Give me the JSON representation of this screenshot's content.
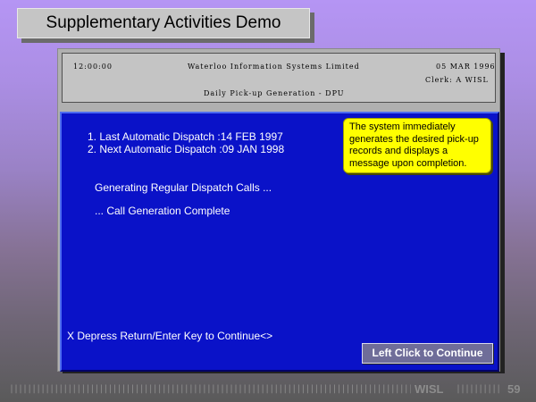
{
  "title": "Supplementary Activities Demo",
  "header": {
    "time": "12:00:00",
    "company": "Waterloo Information Systems Limited",
    "date": "05 MAR 1996",
    "clerk": "Clerk:  A WISL",
    "screen_title": "Daily Pick-up Generation - DPU"
  },
  "main": {
    "line1": "1. Last Automatic Dispatch :14 FEB 1997",
    "line2": "2. Next Automatic Dispatch :09 JAN 1998",
    "status1": "Generating Regular Dispatch Calls ...",
    "status2": "... Call Generation Complete",
    "prompt": "X Depress Return/Enter Key to Continue<>"
  },
  "note": "The system immediately\ngenerates the desired pick-up\nrecords and displays a\nmessage upon completion.",
  "continue_button": "Left Click to Continue",
  "footer": {
    "brand": "WISL",
    "page": "59"
  }
}
